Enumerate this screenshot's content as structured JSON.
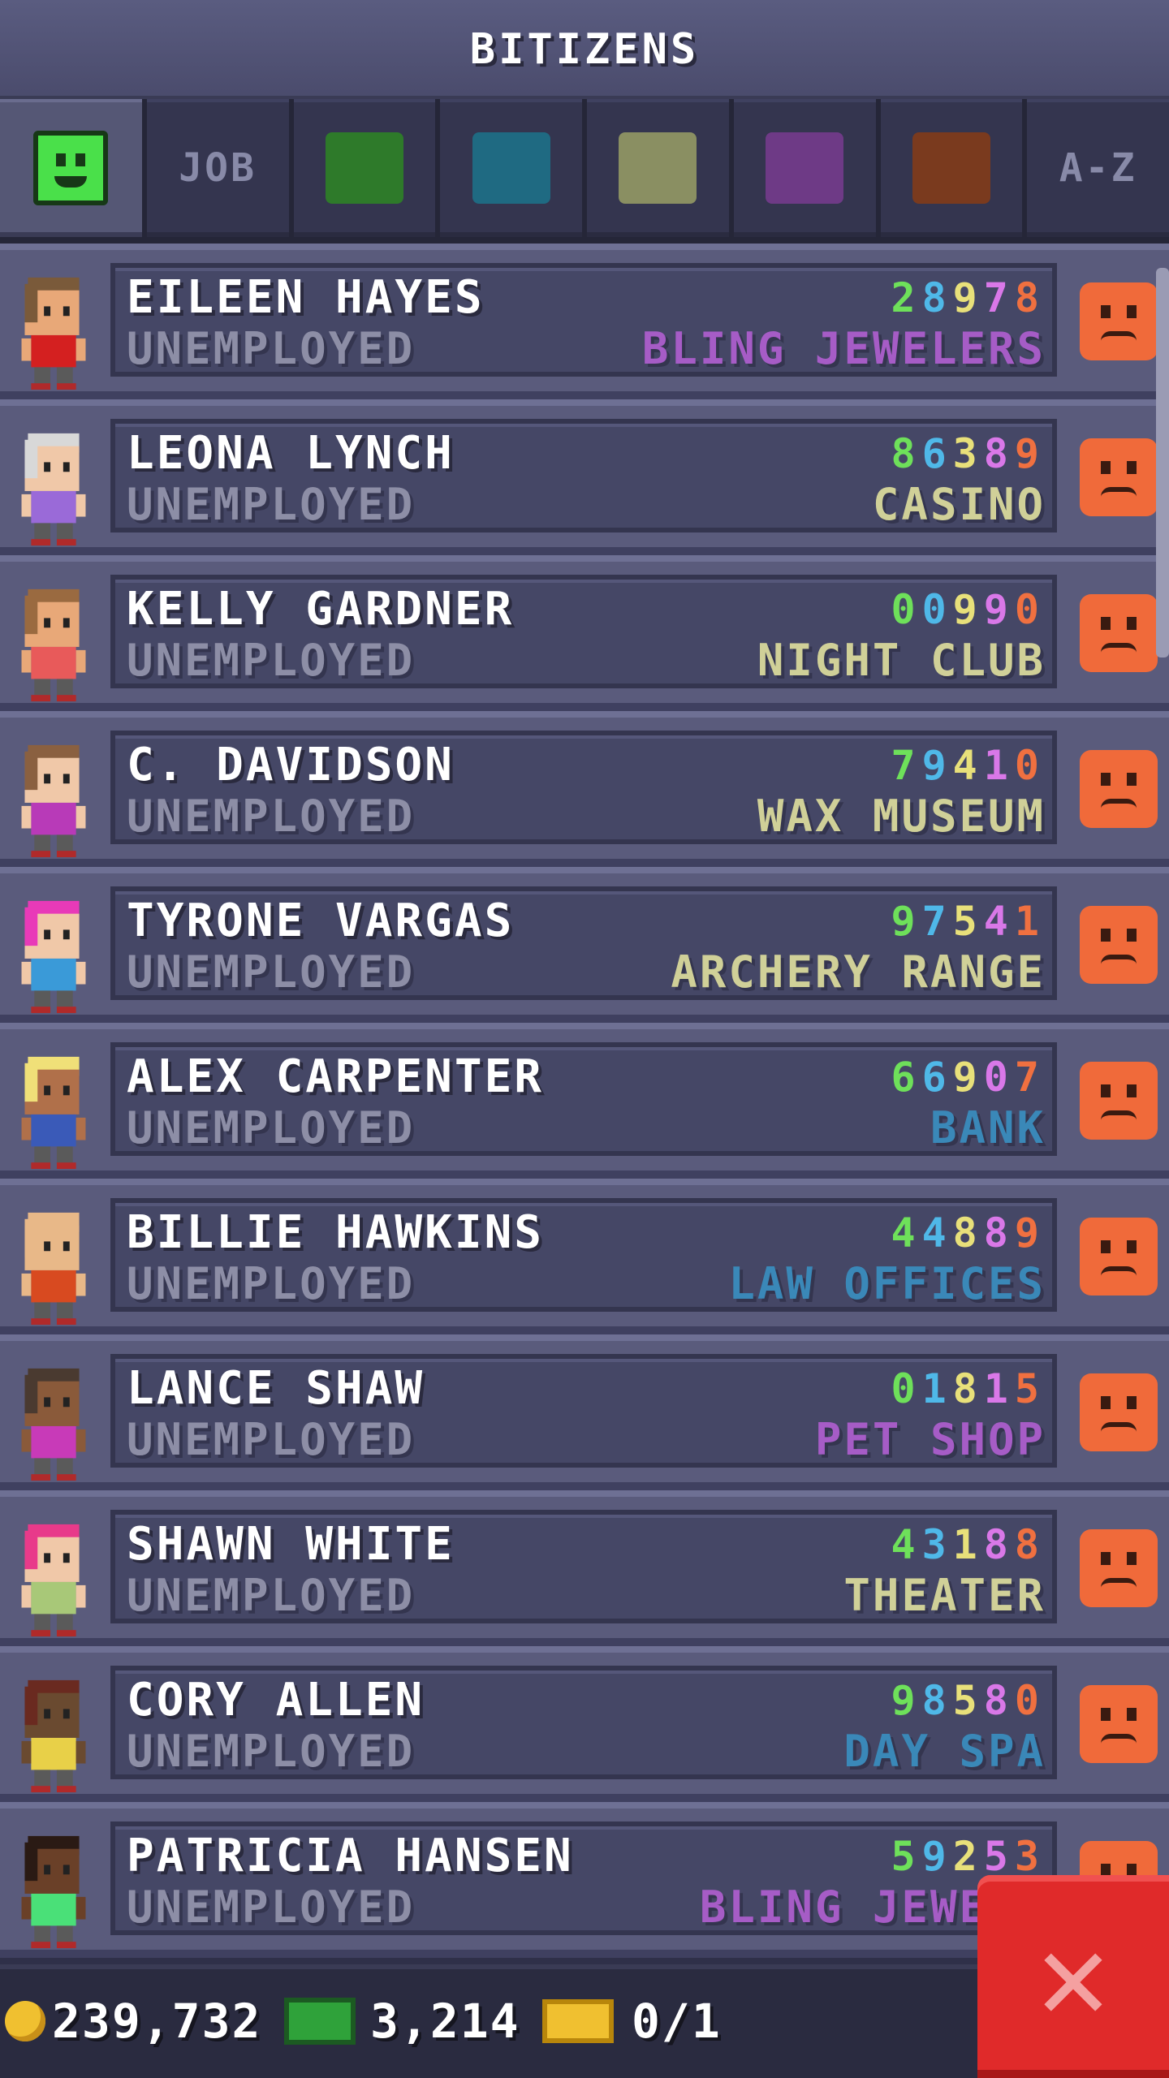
{
  "header": {
    "title": "BITIZENS"
  },
  "tabs": [
    {
      "type": "mood",
      "label": ""
    },
    {
      "type": "text",
      "label": "JOB"
    },
    {
      "type": "color",
      "color": "#2e7a2a"
    },
    {
      "type": "color",
      "color": "#1f6a82"
    },
    {
      "type": "color",
      "color": "#8a8f62"
    },
    {
      "type": "color",
      "color": "#6e3a86"
    },
    {
      "type": "color",
      "color": "#7a3a1e"
    },
    {
      "type": "text",
      "label": "A-Z"
    }
  ],
  "bitizens": [
    {
      "name": "EILEEN HAYES",
      "job": "UNEMPLOYED",
      "digits": [
        "2",
        "8",
        "9",
        "7",
        "8"
      ],
      "dream_job": "BLING JEWELERS",
      "dream_color": "#a65cc6",
      "shirt": "#d42020",
      "hair": "#7a5a3a",
      "skin": "#e8a878"
    },
    {
      "name": "LEONA LYNCH",
      "job": "UNEMPLOYED",
      "digits": [
        "8",
        "6",
        "3",
        "8",
        "9"
      ],
      "dream_job": "CASINO",
      "dream_color": "#d0d098",
      "shirt": "#9a6ad8",
      "hair": "#d8d8d8",
      "skin": "#f0c8a8"
    },
    {
      "name": "KELLY GARDNER",
      "job": "UNEMPLOYED",
      "digits": [
        "0",
        "0",
        "9",
        "9",
        "0"
      ],
      "dream_job": "NIGHT CLUB",
      "dream_color": "#d0d098",
      "shirt": "#e85a5a",
      "hair": "#9a6a40",
      "skin": "#e8a878"
    },
    {
      "name": "C. DAVIDSON",
      "job": "UNEMPLOYED",
      "digits": [
        "7",
        "9",
        "4",
        "1",
        "0"
      ],
      "dream_job": "WAX MUSEUM",
      "dream_color": "#d0d098",
      "shirt": "#b83ab8",
      "hair": "#8a6040",
      "skin": "#f0c8a8"
    },
    {
      "name": "TYRONE VARGAS",
      "job": "UNEMPLOYED",
      "digits": [
        "9",
        "7",
        "5",
        "4",
        "1"
      ],
      "dream_job": "ARCHERY RANGE",
      "dream_color": "#d0d098",
      "shirt": "#3a9ad8",
      "hair": "#e83ab8",
      "skin": "#f0c8a8"
    },
    {
      "name": "ALEX CARPENTER",
      "job": "UNEMPLOYED",
      "digits": [
        "6",
        "6",
        "9",
        "0",
        "7"
      ],
      "dream_job": "BANK",
      "dream_color": "#3a88b8",
      "shirt": "#3a5ab8",
      "hair": "#f0e078",
      "skin": "#b0704a"
    },
    {
      "name": "BILLIE HAWKINS",
      "job": "UNEMPLOYED",
      "digits": [
        "4",
        "4",
        "8",
        "8",
        "9"
      ],
      "dream_job": "LAW OFFICES",
      "dream_color": "#3a88b8",
      "shirt": "#d84a20",
      "hair": "#e8b888",
      "skin": "#e8b888"
    },
    {
      "name": "LANCE SHAW",
      "job": "UNEMPLOYED",
      "digits": [
        "0",
        "1",
        "8",
        "1",
        "5"
      ],
      "dream_job": "PET SHOP",
      "dream_color": "#a65cc6",
      "shirt": "#c83ab8",
      "hair": "#4a3a30",
      "skin": "#8a5a3a"
    },
    {
      "name": "SHAWN WHITE",
      "job": "UNEMPLOYED",
      "digits": [
        "4",
        "3",
        "1",
        "8",
        "8"
      ],
      "dream_job": "THEATER",
      "dream_color": "#d0d098",
      "shirt": "#a8c878",
      "hair": "#e83a8a",
      "skin": "#f0c8a8"
    },
    {
      "name": "CORY ALLEN",
      "job": "UNEMPLOYED",
      "digits": [
        "9",
        "8",
        "5",
        "8",
        "0"
      ],
      "dream_job": "DAY SPA",
      "dream_color": "#3a88b8",
      "shirt": "#e8d048",
      "hair": "#6a2a20",
      "skin": "#6a4a30"
    },
    {
      "name": "PATRICIA HANSEN",
      "job": "UNEMPLOYED",
      "digits": [
        "5",
        "9",
        "2",
        "5",
        "3"
      ],
      "dream_job": "BLING JEWELE",
      "dream_color": "#a65cc6",
      "shirt": "#4ae078",
      "hair": "#2a1a14",
      "skin": "#6a4028"
    }
  ],
  "footer": {
    "coins": "239,732",
    "bux": "3,214",
    "tickets": "0/1"
  },
  "icons": {
    "mood": "sad-face-icon",
    "close": "close-icon",
    "coin": "coin-icon",
    "bux": "bux-icon",
    "ticket": "ticket-icon"
  }
}
